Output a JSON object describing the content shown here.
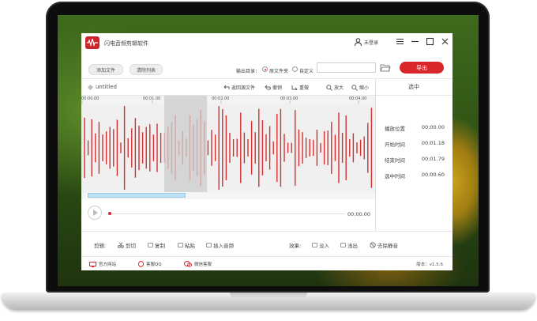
{
  "app": {
    "title": "闪电音频剪辑软件",
    "user_label": "未登录"
  },
  "toolbar": {
    "add_file": "添加文件",
    "clear_list": "清除列表",
    "output_dir_label": "输出目录：",
    "option_original": "原文件夹",
    "option_custom": "自定义",
    "path_value": "",
    "export_label": "导出",
    "selected_option": "原文件夹"
  },
  "editor": {
    "filename": "untitled",
    "tools": [
      "返回源文件",
      "撤销",
      "重做",
      "放大",
      "缩小"
    ],
    "ruler_ticks": [
      "00:00.00",
      "00:01.00",
      "00:02.00",
      "00:03.00",
      "00:04.00"
    ],
    "current_time": "00:00.00",
    "progress": 0
  },
  "selection_panel": {
    "header": "选中",
    "rows": [
      {
        "label": "播放位置",
        "value": "00:00.00"
      },
      {
        "label": "开始时间",
        "value": "00:01.18"
      },
      {
        "label": "结束时间",
        "value": "00:01.79"
      },
      {
        "label": "选中时间",
        "value": "00:00.60"
      }
    ]
  },
  "bottom": {
    "edit_label": "剪辑:",
    "edit_buttons": [
      "剪切",
      "复制",
      "粘贴",
      "插入音频"
    ],
    "effects_label": "效果:",
    "effect_buttons": [
      "淡入",
      "浅出",
      "去除静音"
    ]
  },
  "footer": {
    "links": [
      "官方网站",
      "客服QQ",
      "微信客服"
    ],
    "version": "版本：v1.5.6"
  },
  "colors": {
    "accent": "#d9262b",
    "waveform": "#d32f2f",
    "waveform_selected": "#e8a0a0"
  }
}
